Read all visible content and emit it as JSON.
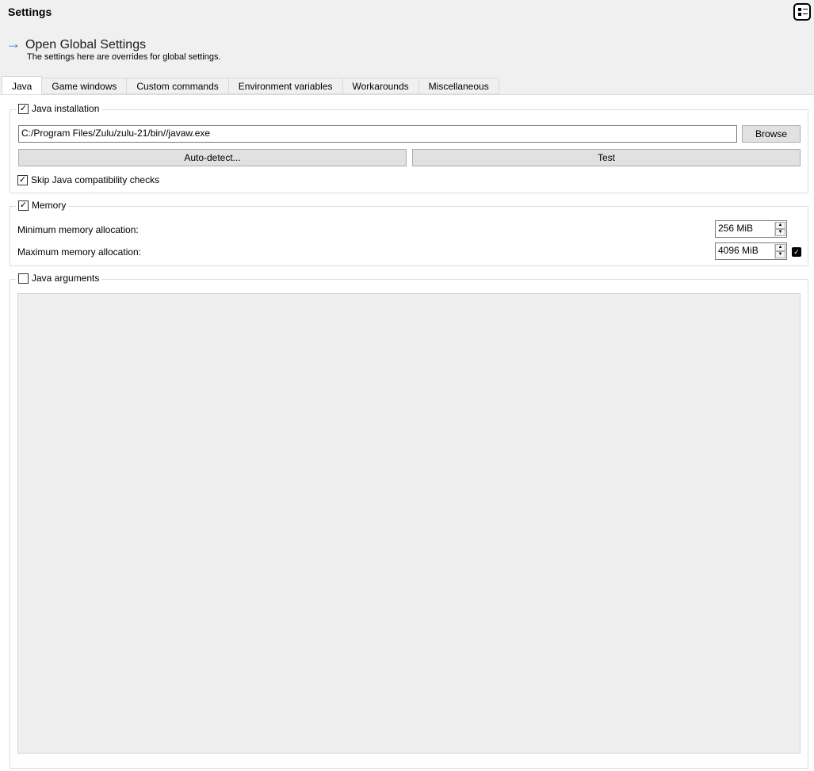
{
  "header": {
    "title": "Settings",
    "menu_icon": "list-settings-icon",
    "link": "Open Global Settings",
    "subtitle": "The settings here are overrides for global settings."
  },
  "tabs": [
    "Java",
    "Game windows",
    "Custom commands",
    "Environment variables",
    "Workarounds",
    "Miscellaneous"
  ],
  "java_installation": {
    "label": "Java installation",
    "checked": true,
    "path": "C:/Program Files/Zulu/zulu-21/bin//javaw.exe",
    "browse": "Browse",
    "autodetect": "Auto-detect...",
    "test": "Test",
    "skip_label": "Skip Java compatibility checks",
    "skip_checked": true
  },
  "memory": {
    "label": "Memory",
    "checked": true,
    "min_label": "Minimum memory allocation:",
    "min_value": "256 MiB",
    "max_label": "Maximum memory allocation:",
    "max_value": "4096 MiB"
  },
  "java_arguments": {
    "label": "Java arguments",
    "checked": false,
    "value": ""
  }
}
